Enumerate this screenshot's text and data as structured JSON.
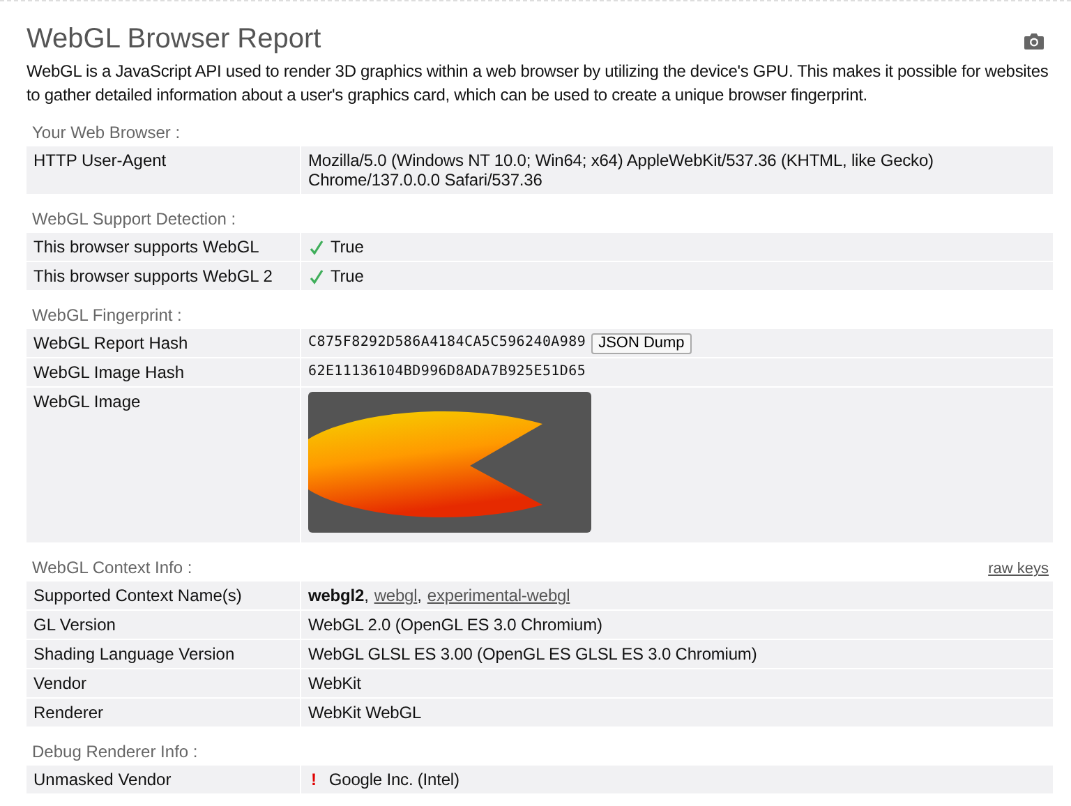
{
  "title": "WebGL Browser Report",
  "description": "WebGL is a JavaScript API used to render 3D graphics within a web browser by utilizing the device's GPU. This makes it possible for websites to gather detailed information about a user's graphics card, which can be used to create a unique browser fingerprint.",
  "sections": [
    {
      "heading": "Your Web Browser :",
      "rows": [
        {
          "kind": "text",
          "label": "HTTP User-Agent",
          "value": "Mozilla/5.0 (Windows NT 10.0; Win64; x64) AppleWebKit/537.36 (KHTML, like Gecko) Chrome/137.0.0.0 Safari/537.36"
        }
      ]
    },
    {
      "heading": "WebGL Support Detection :",
      "rows": [
        {
          "kind": "check",
          "label": "This browser supports WebGL",
          "value": "True"
        },
        {
          "kind": "check",
          "label": "This browser supports WebGL 2",
          "value": "True"
        }
      ]
    },
    {
      "heading": "WebGL Fingerprint :",
      "rows": [
        {
          "kind": "hash",
          "label": "WebGL Report Hash",
          "value": "C875F8292D586A4184CA5C596240A989",
          "button": "JSON Dump"
        },
        {
          "kind": "hash",
          "label": "WebGL Image Hash",
          "value": "62E11136104BD996D8ADA7B925E51D65"
        },
        {
          "kind": "image",
          "label": "WebGL Image"
        }
      ]
    },
    {
      "heading": "WebGL Context Info :",
      "link": "raw keys",
      "rows": [
        {
          "kind": "names",
          "label": "Supported Context Name(s)",
          "separator": ",",
          "names": [
            {
              "text": "webgl2",
              "kind": "current"
            },
            {
              "text": "webgl",
              "kind": "link"
            },
            {
              "text": "experimental-webgl",
              "kind": "link"
            }
          ]
        },
        {
          "kind": "text",
          "label": "GL Version",
          "value": "WebGL 2.0 (OpenGL ES 3.0 Chromium)"
        },
        {
          "kind": "text",
          "label": "Shading Language Version",
          "value": "WebGL GLSL ES 3.00 (OpenGL ES GLSL ES 3.0 Chromium)"
        },
        {
          "kind": "text",
          "label": "Vendor",
          "value": "WebKit"
        },
        {
          "kind": "text",
          "label": "Renderer",
          "value": "WebKit WebGL"
        }
      ]
    },
    {
      "heading": "Debug Renderer Info :",
      "rows": [
        {
          "kind": "warning",
          "label": "Unmasked Vendor",
          "value": "Google Inc. (Intel)",
          "mark": "!"
        }
      ]
    }
  ]
}
